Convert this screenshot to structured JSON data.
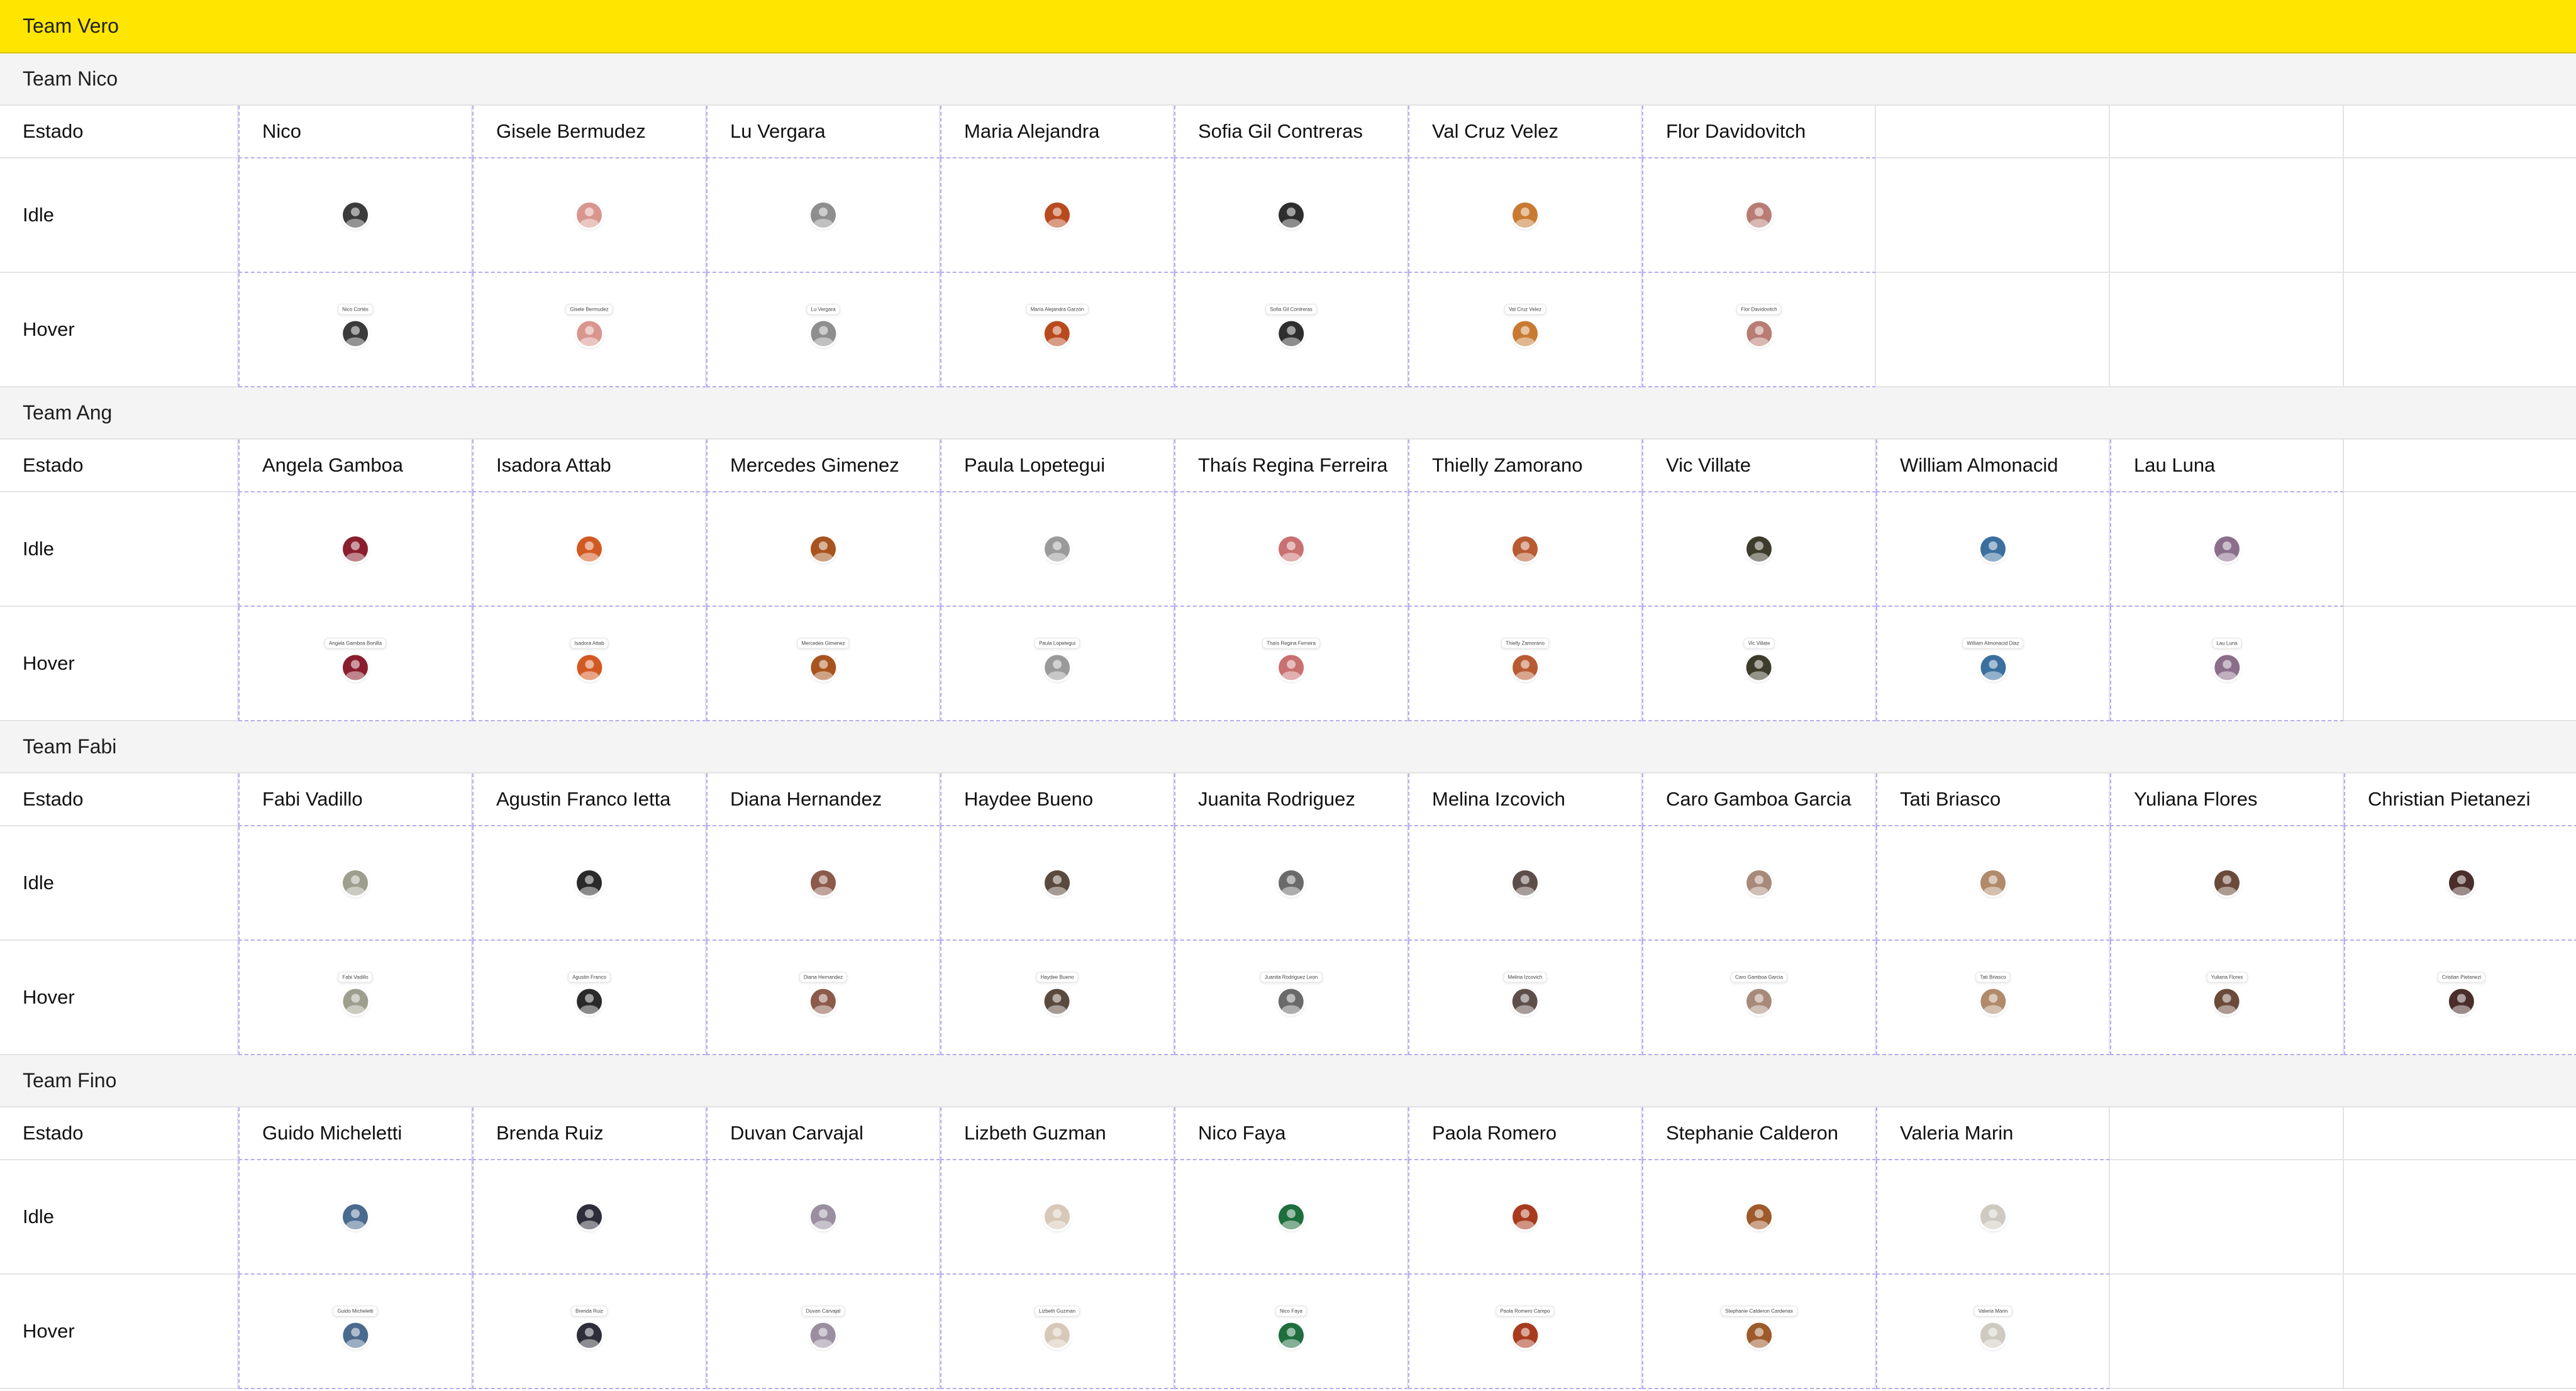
{
  "group_title": "Team Vero",
  "teams": [
    {
      "title": "Team Nico",
      "label_estado": "Estado",
      "label_idle": "Idle",
      "label_hover": "Hover",
      "members": [
        {
          "name": "Nico",
          "tooltip": "Nico Cortés",
          "color": "#3b3b3b"
        },
        {
          "name": "Gisele Bermudez",
          "tooltip": "Gisele Bermudez",
          "color": "#d9968f"
        },
        {
          "name": "Lu Vergara",
          "tooltip": "Lu Vergara",
          "color": "#8e8e8e"
        },
        {
          "name": "Maria Alejandra",
          "tooltip": "María Alejandra Garzón",
          "color": "#b84a1e"
        },
        {
          "name": "Sofia Gil Contreras",
          "tooltip": "Sofia Gil Contreras",
          "color": "#2e2e2e"
        },
        {
          "name": "Val Cruz Velez",
          "tooltip": "Val Cruz Velez",
          "color": "#c97a32"
        },
        {
          "name": "Flor Davidovitch",
          "tooltip": "Flor Davidovitch",
          "color": "#b87c74"
        }
      ]
    },
    {
      "title": "Team Ang",
      "label_estado": "Estado",
      "label_idle": "Idle",
      "label_hover": "Hover",
      "members": [
        {
          "name": "Angela Gamboa",
          "tooltip": "Angela Gamboa Bonilla",
          "color": "#8b1e2e"
        },
        {
          "name": "Isadora Attab",
          "tooltip": "Isadora Attab",
          "color": "#d25a22"
        },
        {
          "name": "Mercedes Gimenez",
          "tooltip": "Mercedes Gimenez",
          "color": "#a8541e"
        },
        {
          "name": "Paula Lopetegui",
          "tooltip": "Paula Lopetegui",
          "color": "#9a9a9a"
        },
        {
          "name": "Thaís Regina Ferreira",
          "tooltip": "Thaís Regina Ferreira",
          "color": "#c97070"
        },
        {
          "name": "Thielly Zamorano",
          "tooltip": "Thielly Zamorano",
          "color": "#b85a32"
        },
        {
          "name": "Vic Villate",
          "tooltip": "Vic Villate",
          "color": "#3d3b2a"
        },
        {
          "name": "William Almonacid",
          "tooltip": "William Almonacid Diaz",
          "color": "#3a6f9e"
        },
        {
          "name": "Lau Luna",
          "tooltip": "Lau Luna",
          "color": "#8a6e8a"
        }
      ]
    },
    {
      "title": "Team Fabi",
      "label_estado": "Estado",
      "label_idle": "Idle",
      "label_hover": "Hover",
      "members": [
        {
          "name": "Fabi Vadillo",
          "tooltip": "Fabi Vadillo",
          "color": "#9e9e8e"
        },
        {
          "name": "Agustin Franco Ietta",
          "tooltip": "Agustin Franco",
          "color": "#2a2a2a"
        },
        {
          "name": "Diana Hernandez",
          "tooltip": "Diana Hernandez",
          "color": "#8b5a4a"
        },
        {
          "name": "Haydee Bueno",
          "tooltip": "Haydee Bueno",
          "color": "#5a4a3e"
        },
        {
          "name": "Juanita Rodriguez",
          "tooltip": "Juanita Rodriguez Leon",
          "color": "#6a6a6a"
        },
        {
          "name": "Melina Izcovich",
          "tooltip": "Melina Izcovich",
          "color": "#5e4e4a"
        },
        {
          "name": "Caro Gamboa Garcia",
          "tooltip": "Caro Gamboa Garcia",
          "color": "#a88a7a"
        },
        {
          "name": "Tati Briasco",
          "tooltip": "Tati Briasco",
          "color": "#b08a6a"
        },
        {
          "name": "Yuliana Flores",
          "tooltip": "Yuliana Flores",
          "color": "#6a4a3a"
        },
        {
          "name": "Christian Pietanezi",
          "tooltip": "Cristian Pietanezi",
          "color": "#4a2e2a"
        }
      ]
    },
    {
      "title": "Team Fino",
      "label_estado": "Estado",
      "label_idle": "Idle",
      "label_hover": "Hover",
      "members": [
        {
          "name": "Guido Micheletti",
          "tooltip": "Guido Micheletti",
          "color": "#4a6a8e"
        },
        {
          "name": "Brenda Ruiz",
          "tooltip": "Brenda Ruiz",
          "color": "#2e2e3a"
        },
        {
          "name": "Duvan Carvajal",
          "tooltip": "Duvan Carvajal",
          "color": "#9a8ea0"
        },
        {
          "name": "Lizbeth Guzman",
          "tooltip": "Lizbeth Guzman",
          "color": "#d8c8b8"
        },
        {
          "name": "Nico Faya",
          "tooltip": "Nico Faya",
          "color": "#1e6e3e"
        },
        {
          "name": "Paola Romero",
          "tooltip": "Paola Romero Campo",
          "color": "#a83a1e"
        },
        {
          "name": "Stephanie Calderon",
          "tooltip": "Stephanie Calderon Cardenas",
          "color": "#9e5a2a"
        },
        {
          "name": "Valeria Marin",
          "tooltip": "Valeria Marin",
          "color": "#cfcac0"
        }
      ]
    }
  ]
}
